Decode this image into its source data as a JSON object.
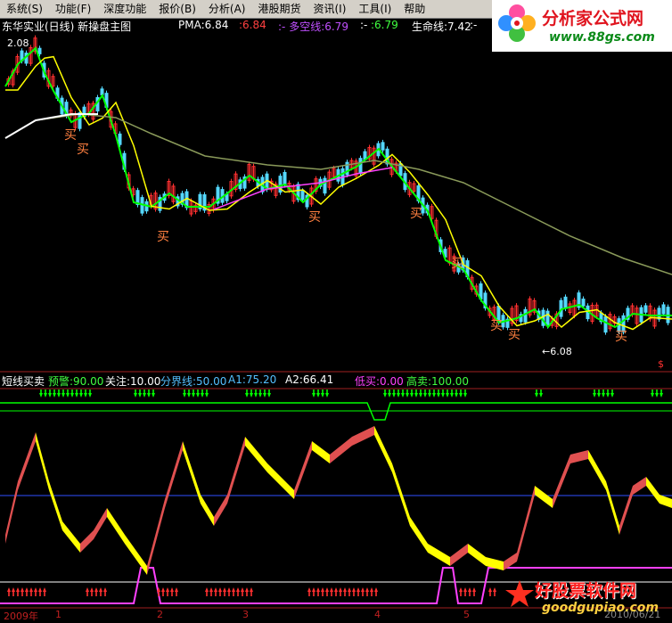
{
  "menu": [
    "系统(S)",
    "功能(F)",
    "深度功能",
    "报价(B)",
    "分析(A)",
    "港股期货",
    "资讯(I)",
    "工具(I)",
    "帮助"
  ],
  "logo_top": {
    "brand": "分析家公式网",
    "url": "www.88gs.com"
  },
  "title": {
    "stock": "东华实业(日线) 新操盘主图",
    "pma": "PMA:6.84",
    "pma_alt": ":6.84",
    "dkx_label": ":- 多空线:6.79",
    "dkx_sep": ":-",
    "dkx_alt": ":6.79",
    "life": "生命线:7.42",
    "life_tail": ":-"
  },
  "price_chart": {
    "high_label": "2.08",
    "low_label": "←6.08",
    "buy_label": "买",
    "dollar": "$"
  },
  "indicator": {
    "name": "短线买卖",
    "warn": "预警:90.00",
    "focus": "关注:10.00",
    "divide": "分界线:50.00",
    "a1": "A1:75.20",
    "a2": "A2:66.41",
    "low_buy": "低买:0.00",
    "high_sell": "高卖:100.00"
  },
  "dates": {
    "y2009": "2009年",
    "m1": "1",
    "m2": "2",
    "m3": "3",
    "m4": "4",
    "m5": "5",
    "tail": "2010/06/21"
  },
  "logo_bottom": {
    "brand": "好股票软件网",
    "url": "goodgupiao.com"
  },
  "colors": {
    "up": "#ff3030",
    "down": "#54d8ff",
    "green": "#00ff00",
    "yellow": "#ffff00",
    "white": "#ffffff",
    "magenta": "#ff40ff",
    "olive": "#8a9a5a",
    "red": "#e05050"
  }
}
